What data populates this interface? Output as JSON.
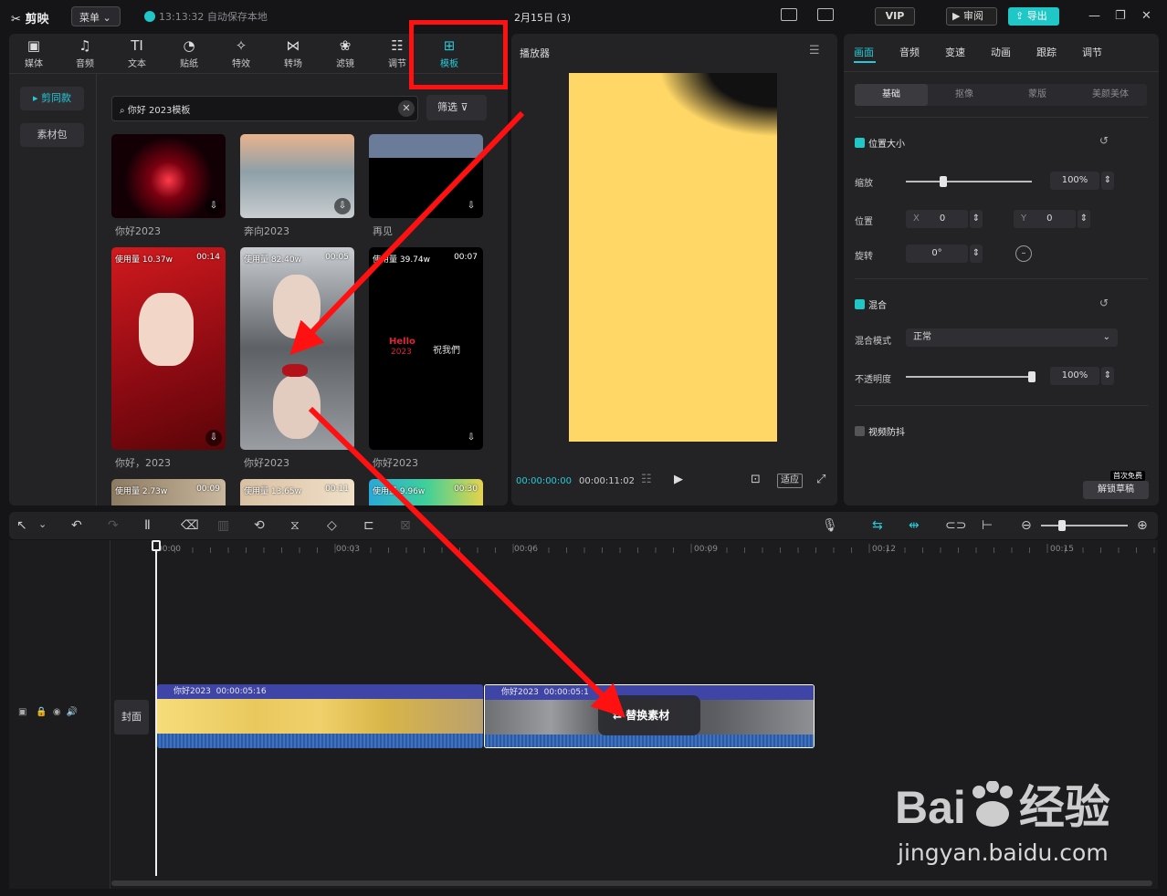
{
  "app": {
    "name": "剪映",
    "menu_label": "菜单",
    "save_status": "13:13:32 自动保存本地",
    "project_title": "2月15日 (3)"
  },
  "header": {
    "vip": "VIP",
    "review": "审阅",
    "export": "导出"
  },
  "tabs": [
    {
      "label": "媒体",
      "icon": "media-icon"
    },
    {
      "label": "音频",
      "icon": "audio-icon"
    },
    {
      "label": "文本",
      "icon": "text-icon",
      "glyph": "TI"
    },
    {
      "label": "贴纸",
      "icon": "sticker-icon"
    },
    {
      "label": "特效",
      "icon": "effects-icon"
    },
    {
      "label": "转场",
      "icon": "transition-icon"
    },
    {
      "label": "滤镜",
      "icon": "filter-icon"
    },
    {
      "label": "调节",
      "icon": "adjust-icon"
    },
    {
      "label": "模板",
      "icon": "template-icon",
      "active": true
    }
  ],
  "sidebar": {
    "items": [
      {
        "label": "剪同款",
        "active": true
      },
      {
        "label": "素材包"
      }
    ]
  },
  "search": {
    "value": "你好 2023模板",
    "filter_label": "筛选"
  },
  "templates": [
    {
      "title": "你好2023"
    },
    {
      "title": "奔向2023"
    },
    {
      "title": "再见"
    },
    {
      "title": "你好，2023",
      "usage": "使用量 10.37w",
      "duration": "00:14"
    },
    {
      "title": "你好2023",
      "usage": "使用量 82.40w",
      "duration": "00:05"
    },
    {
      "title": "你好2023",
      "usage": "使用量 39.74w",
      "duration": "00:07",
      "overlay1": "Hello",
      "overlay2": "2023",
      "overlay3": "祝我們"
    },
    {
      "usage": "使用量 2.73w",
      "duration": "00:09"
    },
    {
      "usage": "使用量 13.65w",
      "duration": "00:11"
    },
    {
      "usage": "使用量 9.96w",
      "duration": "00:30"
    }
  ],
  "player": {
    "title": "播放器",
    "current_time": "00:00:00:00",
    "total_time": "00:00:11:02",
    "fit_label": "适应"
  },
  "inspector": {
    "tabs": [
      "画面",
      "音频",
      "变速",
      "动画",
      "跟踪",
      "调节"
    ],
    "subtabs": [
      "基础",
      "抠像",
      "蒙版",
      "美颜美体"
    ],
    "position_size": "位置大小",
    "scale_label": "缩放",
    "scale_value": "100%",
    "scale_level": 0.3,
    "position_label": "位置",
    "x_label": "X",
    "x_value": "0",
    "y_label": "Y",
    "y_value": "0",
    "rotate_label": "旋转",
    "rotate_value": "0°",
    "blend_header": "混合",
    "blend_mode_label": "混合模式",
    "blend_mode_value": "正常",
    "opacity_label": "不透明度",
    "opacity_value": "100%",
    "opacity_level": 1.0,
    "stabilize": "视频防抖",
    "first_free": "首次免费",
    "unlock_draft": "解锁草稿"
  },
  "timeline": {
    "ruler": [
      "00:00",
      "00:03",
      "00:06",
      "00:09",
      "00:12",
      "00:15"
    ],
    "cover_label": "封面",
    "clips": [
      {
        "title": "你好2023",
        "duration": "00:00:05:16"
      },
      {
        "title": "你好2023",
        "duration": "00:00:05:1"
      }
    ],
    "replace_label": "替换素材"
  },
  "watermark": {
    "brand": "Bai",
    "brand_cn": "经验",
    "url": "jingyan.baidu.com"
  },
  "colors": {
    "accent": "#26c9d6",
    "annotation": "#ff1111",
    "clip_header": "#3e45a7",
    "preview_fill": "#ffd767"
  }
}
